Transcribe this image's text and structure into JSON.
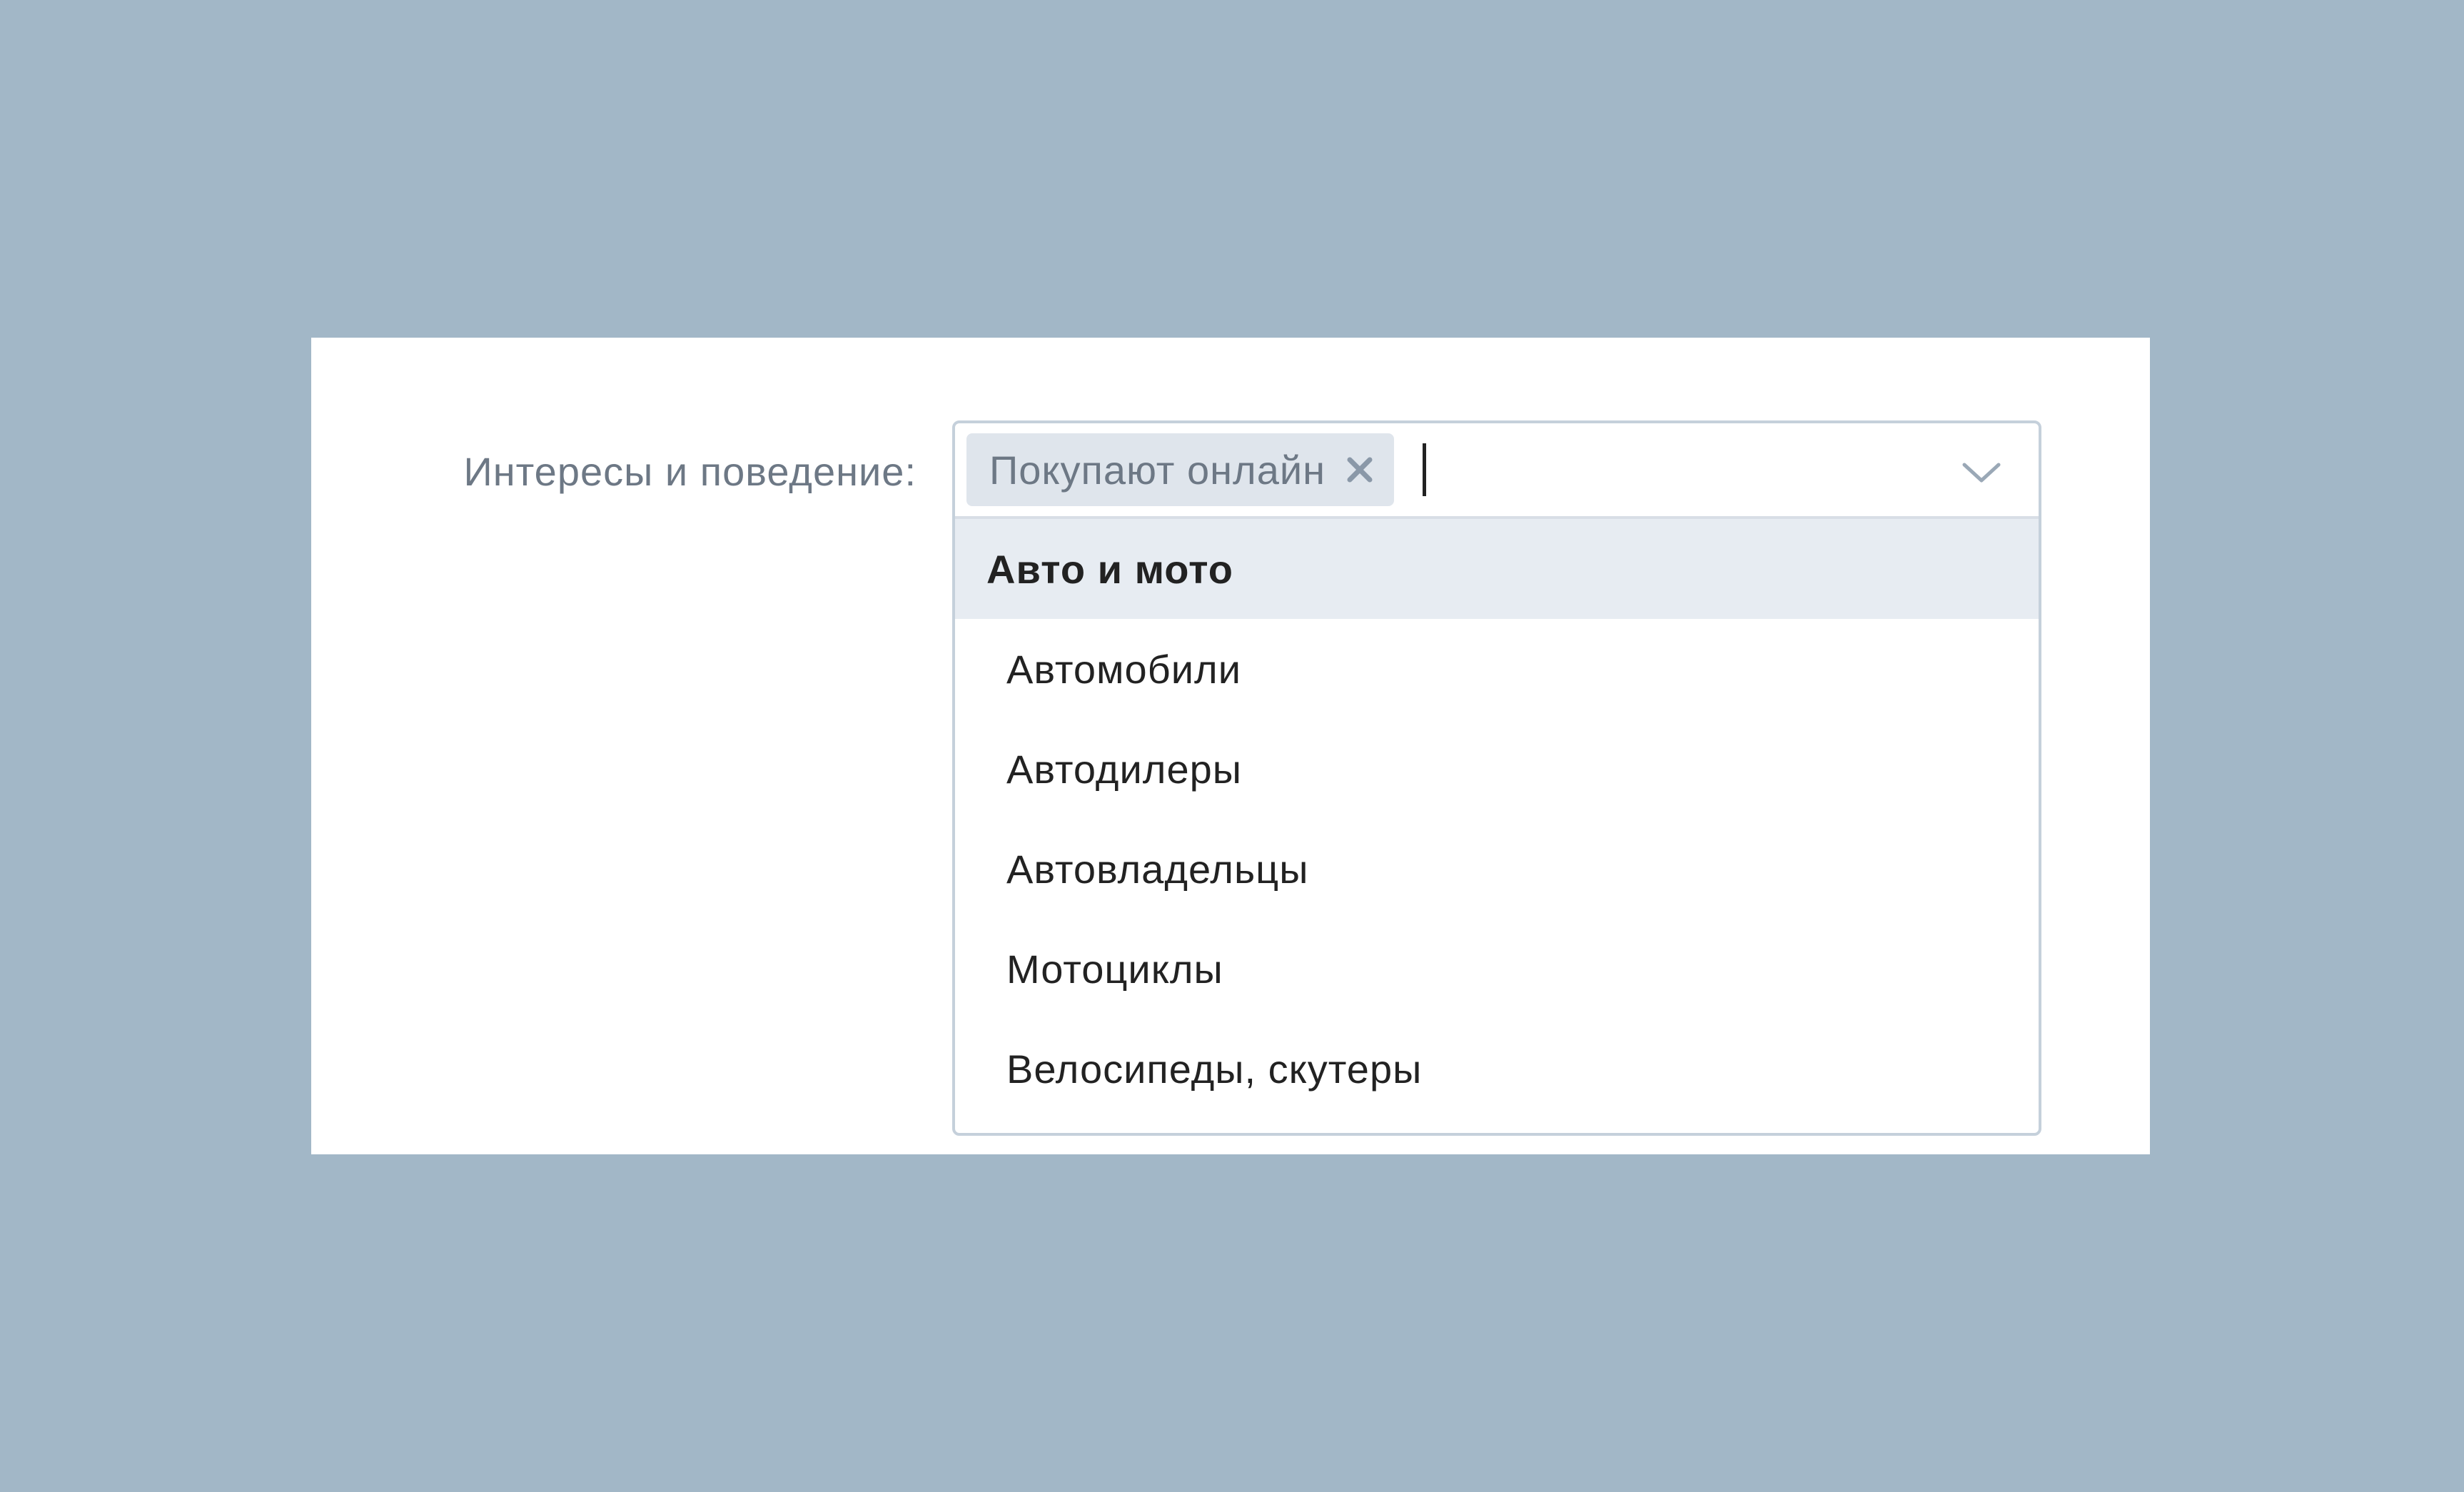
{
  "form": {
    "label": "Интересы и поведение:"
  },
  "select": {
    "chips": [
      {
        "label": "Покупают онлайн"
      }
    ],
    "input_value": "",
    "group": {
      "title": "Авто и мото",
      "options": [
        "Автомобили",
        "Автодилеры",
        "Автовладельцы",
        "Мотоциклы",
        "Велосипеды, скутеры"
      ]
    }
  },
  "icons": {
    "chip_remove": "close-icon",
    "dropdown": "chevron-down-icon"
  },
  "colors": {
    "background": "#a2b7c7",
    "card": "#ffffff",
    "label_text": "#6d7885",
    "chip_bg": "#dfe5ec",
    "chip_text": "#6d7885",
    "highlight_bg": "#e7ecf2",
    "border": "#c5d0db",
    "option_text": "#222222"
  }
}
